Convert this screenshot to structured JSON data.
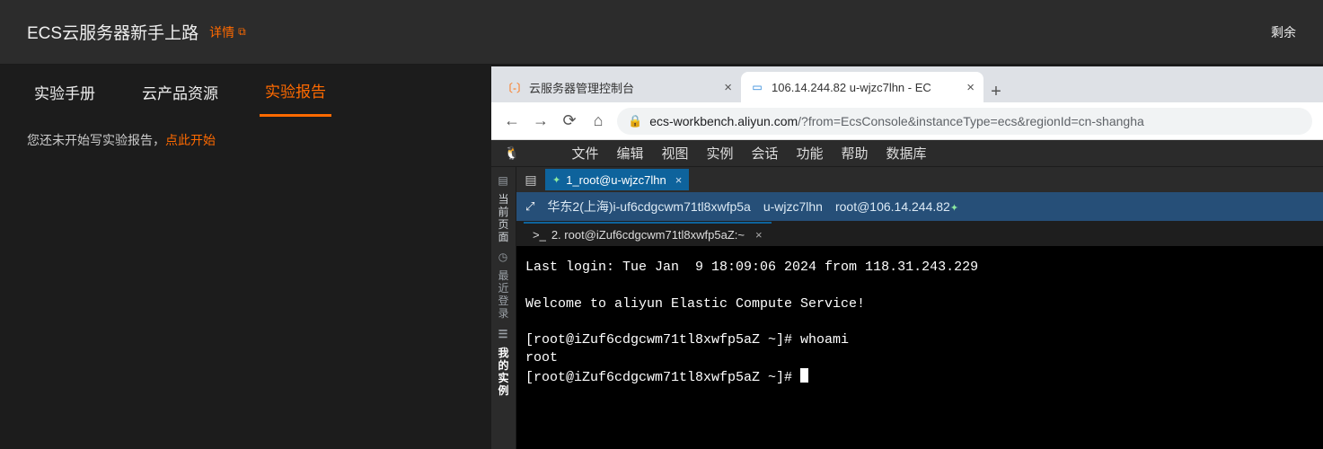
{
  "header": {
    "title": "ECS云服务器新手上路",
    "details_link": "详情",
    "right_label": "剩余"
  },
  "tabs": {
    "manual": "实验手册",
    "resources": "云产品资源",
    "report": "实验报告"
  },
  "report": {
    "prefix": "您还未开始写实验报告，",
    "start": "点此开始"
  },
  "browser": {
    "tab1_label": "云服务器管理控制台",
    "tab2_label": "106.14.244.82 u-wjzc7lhn - EC",
    "url_host": "ecs-workbench.aliyun.com",
    "url_rest": "/?from=EcsConsole&instanceType=ecs&regionId=cn-shangha"
  },
  "workbench": {
    "menu": {
      "file": "文件",
      "edit": "编辑",
      "view": "视图",
      "instance": "实例",
      "session": "会话",
      "feature": "功能",
      "help": "帮助",
      "db": "数据库"
    },
    "side": {
      "current": "当前页面",
      "recent": "最近登录",
      "mine": "我的实例"
    },
    "session_tab": "1_root@u-wjzc7lhn",
    "info": {
      "region_instance": "华东2(上海)i-uf6cdgcwm71tl8xwfp5a",
      "hostname": "u-wjzc7lhn",
      "connection": "root@106.14.244.82"
    },
    "term_tab": "2. root@iZuf6cdgcwm71tl8xwfp5aZ:~",
    "terminal": {
      "line1": "Last login: Tue Jan  9 18:09:06 2024 from 118.31.243.229",
      "line2": "",
      "line3": "Welcome to aliyun Elastic Compute Service!",
      "line4": "",
      "line5": "[root@iZuf6cdgcwm71tl8xwfp5aZ ~]# whoami",
      "line6": "root",
      "line7": "[root@iZuf6cdgcwm71tl8xwfp5aZ ~]# "
    }
  }
}
